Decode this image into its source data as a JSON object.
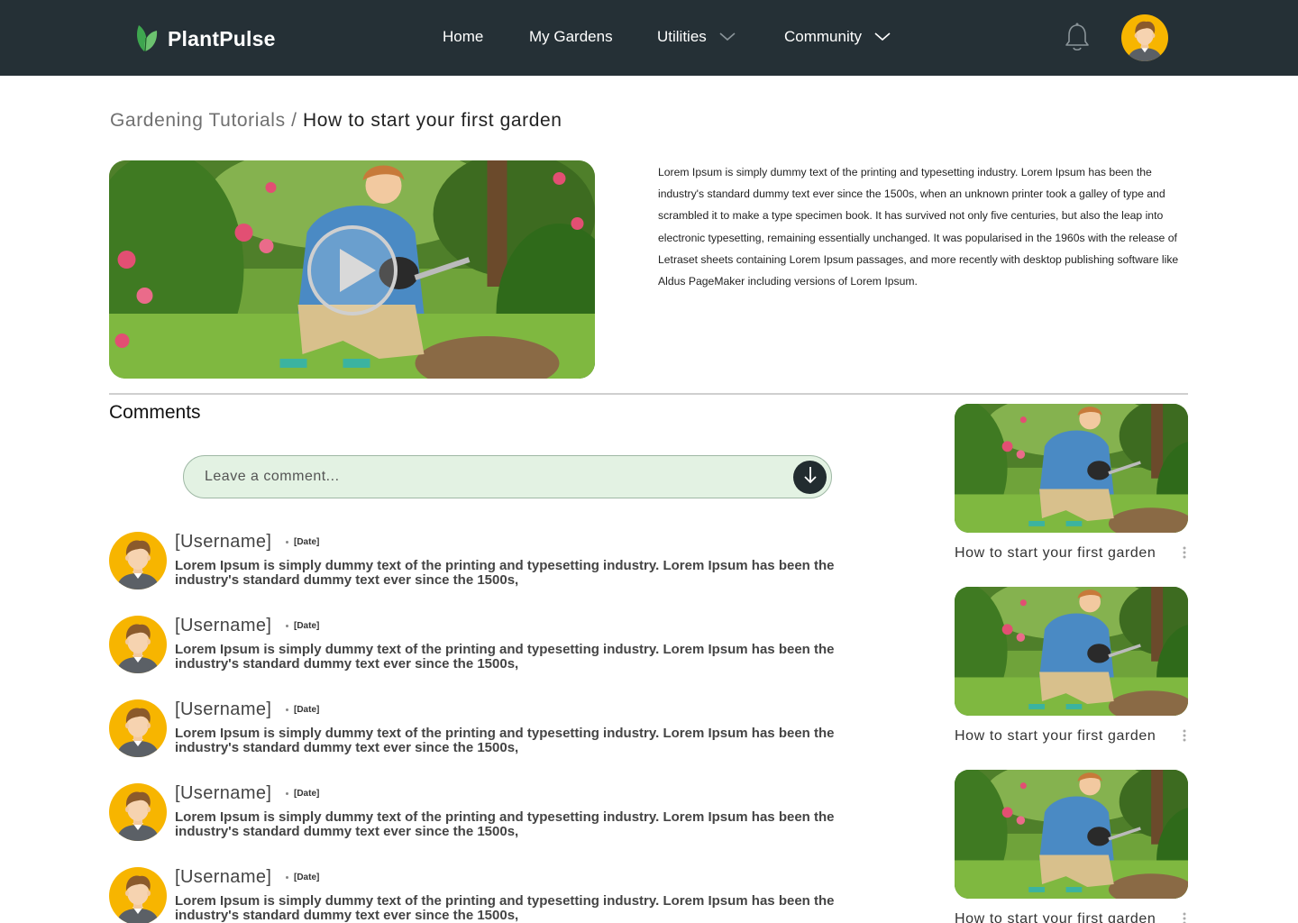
{
  "app": {
    "name": "PlantPulse"
  },
  "nav": {
    "home": "Home",
    "gardens": "My Gardens",
    "utilities": "Utilities",
    "community": "Community"
  },
  "breadcrumb": {
    "parent": "Gardening Tutorials",
    "separator": " / ",
    "current": "How to start your first garden"
  },
  "video": {
    "description": "Lorem Ipsum is simply dummy text of the printing and typesetting industry. Lorem Ipsum has been the industry's standard dummy text ever since the 1500s, when an unknown printer took a galley of type and scrambled it to make a type specimen book. It has survived not only five centuries, but also the leap into electronic typesetting, remaining essentially unchanged. It was popularised in the 1960s with the release of Letraset sheets containing Lorem Ipsum passages, and more recently with desktop publishing software like Aldus PageMaker including versions of Lorem Ipsum."
  },
  "comments": {
    "title": "Comments",
    "input_placeholder": "Leave a comment...",
    "items": [
      {
        "username": "[Username]",
        "date": "[Date]",
        "text": "Lorem Ipsum is simply dummy text of the printing and typesetting industry. Lorem Ipsum has been the industry's standard dummy text ever since the 1500s,"
      },
      {
        "username": "[Username]",
        "date": "[Date]",
        "text": "Lorem Ipsum is simply dummy text of the printing and typesetting industry. Lorem Ipsum has been the industry's standard dummy text ever since the 1500s,"
      },
      {
        "username": "[Username]",
        "date": "[Date]",
        "text": "Lorem Ipsum is simply dummy text of the printing and typesetting industry. Lorem Ipsum has been the industry's standard dummy text ever since the 1500s,"
      },
      {
        "username": "[Username]",
        "date": "[Date]",
        "text": "Lorem Ipsum is simply dummy text of the printing and typesetting industry. Lorem Ipsum has been the industry's standard dummy text ever since the 1500s,"
      },
      {
        "username": "[Username]",
        "date": "[Date]",
        "text": "Lorem Ipsum is simply dummy text of the printing and typesetting industry. Lorem Ipsum has been the industry's standard dummy text ever since the 1500s,"
      }
    ]
  },
  "recommended": [
    {
      "title": "How to start your first garden"
    },
    {
      "title": "How to start your first garden"
    },
    {
      "title": "How to start your first garden"
    }
  ],
  "colors": {
    "header_bg": "#253036",
    "accent_green": "#4caf50",
    "comment_box_bg": "#e3f2e3",
    "avatar_bg": "#f7b500"
  },
  "icons": {
    "logo": "leaf-icon",
    "notifications": "bell-icon",
    "send": "arrow-down-icon",
    "play": "play-icon",
    "more": "more-vertical-icon"
  }
}
